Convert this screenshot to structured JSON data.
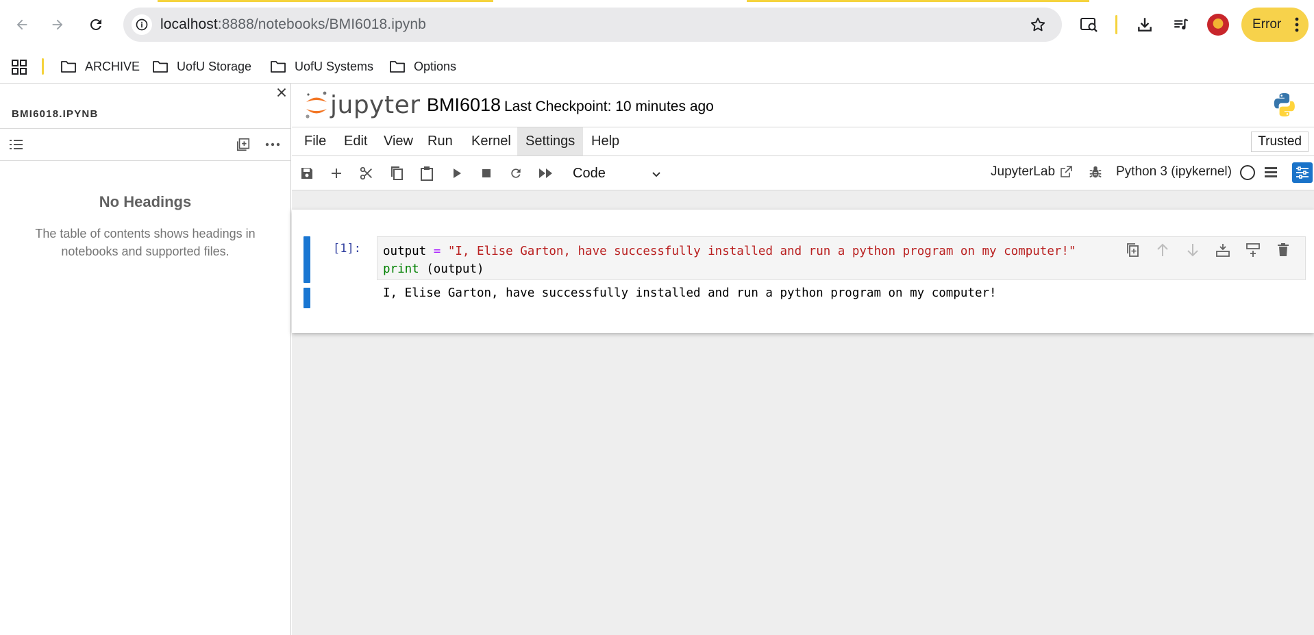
{
  "browser": {
    "url_host": "localhost",
    "url_rest": ":8888/notebooks/BMI6018.ipynb",
    "error_label": "Error",
    "colors": {
      "accent_yellow": "#f5d33d",
      "error_pill": "#f7d24b"
    },
    "icons": [
      "back-icon",
      "forward-icon",
      "reload-icon",
      "site-info-icon",
      "star-icon",
      "search-lens-icon",
      "download-icon",
      "media-icon",
      "avatar",
      "more-vert-icon"
    ]
  },
  "bookmarks": {
    "items": [
      {
        "label": "ARCHIVE"
      },
      {
        "label": "UofU Storage"
      },
      {
        "label": "UofU Systems"
      },
      {
        "label": "Options"
      }
    ]
  },
  "toc": {
    "title": "BMI6018.IPYNB",
    "empty_heading": "No Headings",
    "empty_desc": "The table of contents shows headings in notebooks and supported files."
  },
  "notebook": {
    "logo_text": "jupyter",
    "name": "BMI6018",
    "checkpoint": "Last Checkpoint: 10 minutes ago",
    "menu": [
      "File",
      "Edit",
      "View",
      "Run",
      "Kernel",
      "Settings",
      "Help"
    ],
    "active_menu": "Settings",
    "trusted": "Trusted",
    "cell_type": "Code",
    "jupyterlab_link": "JupyterLab",
    "kernel": "Python 3 (ipykernel)",
    "colors": {
      "cell_active": "#1976d2",
      "prompt": "#303f9f",
      "string": "#ba2121",
      "keyword": "#008000",
      "operator": "#aa22ff"
    },
    "cell": {
      "prompt": "[1]:",
      "code_line1_var": "output",
      "code_line1_op": "=",
      "code_line1_str": "\"I, Elise Garton, have successfully installed and run a python program on my computer!\"",
      "code_line2_kw": "print",
      "code_line2_rest": " (output)",
      "output": "I, Elise Garton, have successfully installed and run a python program on my computer!"
    }
  }
}
